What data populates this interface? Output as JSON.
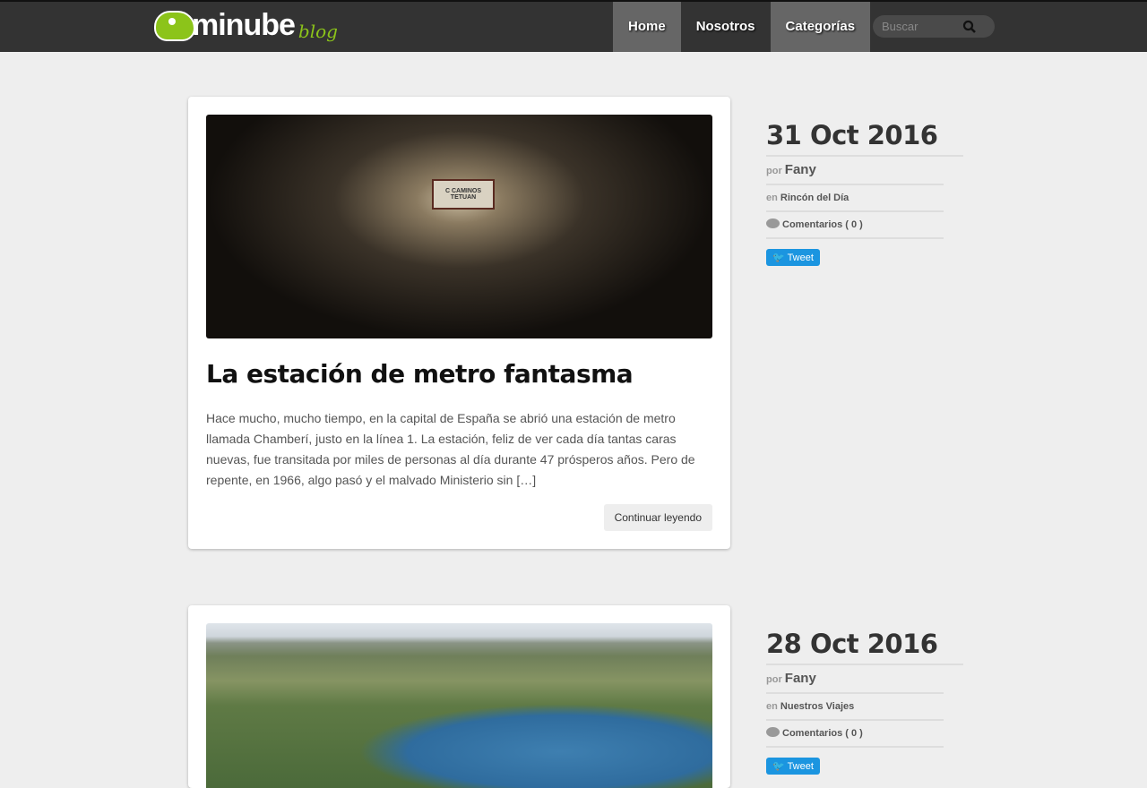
{
  "header": {
    "logo_text": "minube",
    "logo_sub": "blog",
    "nav": [
      {
        "label": "Home"
      },
      {
        "label": "Nosotros"
      },
      {
        "label": "Categorías"
      }
    ],
    "search_placeholder": "Buscar"
  },
  "posts": [
    {
      "title": "La estación de metro fantasma",
      "sign_text": "C CAMINOS TETUAN",
      "excerpt": "Hace mucho, mucho tiempo, en la capital de España se abrió una estación de metro llamada Chamberí, justo en la línea 1. La estación, feliz de ver cada día tantas caras nuevas, fue transitada por miles de personas al día durante 47 prósperos años. Pero de repente, en 1966, algo pasó y el malvado Ministerio sin […]",
      "more": "Continuar leyendo",
      "date": "31 Oct 2016",
      "por": "por",
      "author": "Fany",
      "en": "en",
      "category": "Rincón del Día",
      "comments": "Comentarios ( 0 )",
      "tweet": "Tweet"
    },
    {
      "date": "28 Oct 2016",
      "por": "por",
      "author": "Fany",
      "en": "en",
      "category": "Nuestros Viajes",
      "comments": "Comentarios ( 0 )",
      "tweet": "Tweet"
    }
  ]
}
